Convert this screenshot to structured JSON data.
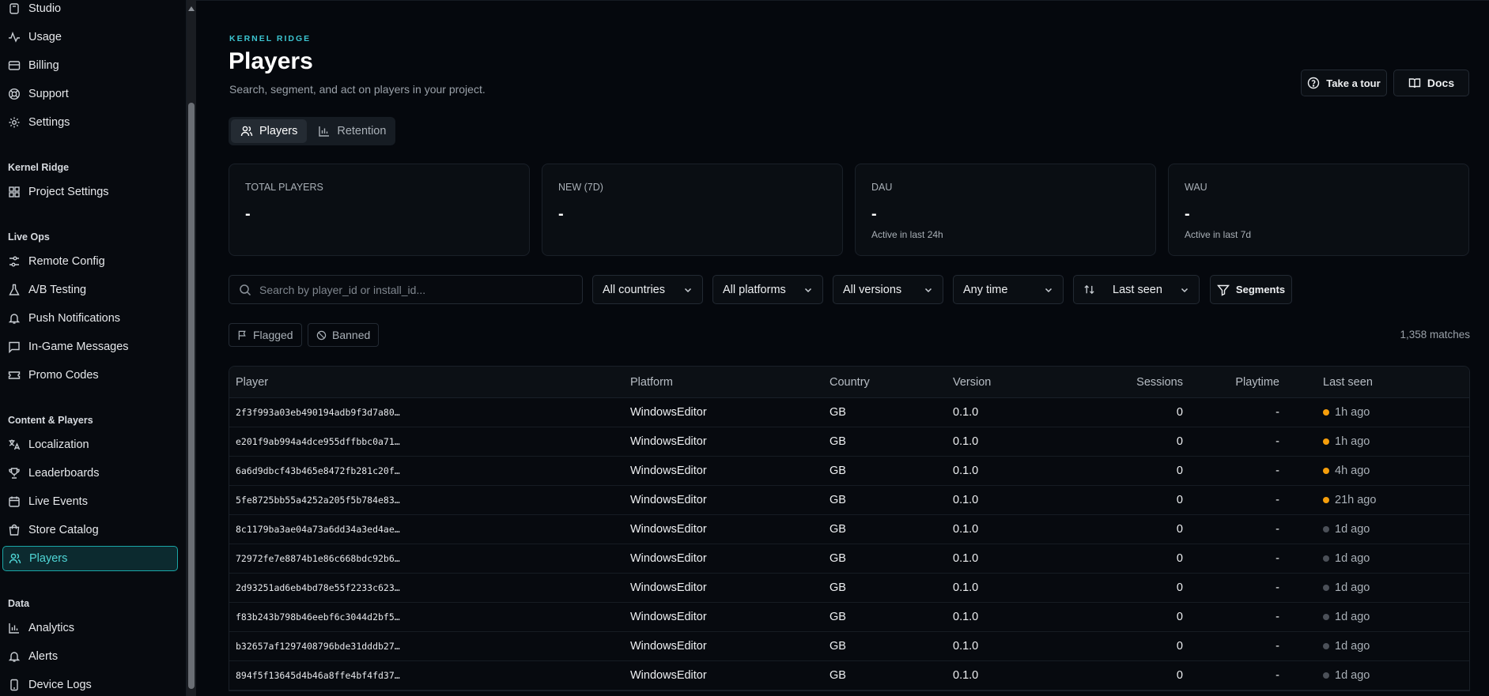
{
  "sidebar": {
    "top_items": [
      {
        "label": "Studio",
        "icon": "studio-icon"
      },
      {
        "label": "Usage",
        "icon": "activity-icon"
      },
      {
        "label": "Billing",
        "icon": "credit-card-icon"
      },
      {
        "label": "Support",
        "icon": "lifebuoy-icon"
      },
      {
        "label": "Settings",
        "icon": "gear-icon"
      }
    ],
    "sections": [
      {
        "title": "Kernel Ridge",
        "items": [
          {
            "label": "Project Settings",
            "icon": "grid-icon"
          }
        ]
      },
      {
        "title": "Live Ops",
        "items": [
          {
            "label": "Remote Config",
            "icon": "sliders-icon"
          },
          {
            "label": "A/B Testing",
            "icon": "flask-icon"
          },
          {
            "label": "Push Notifications",
            "icon": "bell-icon"
          },
          {
            "label": "In-Game Messages",
            "icon": "message-icon"
          },
          {
            "label": "Promo Codes",
            "icon": "ticket-icon"
          }
        ]
      },
      {
        "title": "Content & Players",
        "items": [
          {
            "label": "Localization",
            "icon": "translate-icon"
          },
          {
            "label": "Leaderboards",
            "icon": "trophy-icon"
          },
          {
            "label": "Live Events",
            "icon": "calendar-icon"
          },
          {
            "label": "Store Catalog",
            "icon": "shopping-bag-icon"
          },
          {
            "label": "Players",
            "icon": "users-icon",
            "active": true
          }
        ]
      },
      {
        "title": "Data",
        "items": [
          {
            "label": "Analytics",
            "icon": "bar-chart-icon"
          },
          {
            "label": "Alerts",
            "icon": "bell-icon"
          },
          {
            "label": "Device Logs",
            "icon": "smartphone-icon"
          }
        ]
      }
    ]
  },
  "header": {
    "eyebrow": "KERNEL RIDGE",
    "title": "Players",
    "subtitle": "Search, segment, and act on players in your project.",
    "tour_label": "Take a tour",
    "docs_label": "Docs"
  },
  "tabs": [
    {
      "label": "Players",
      "icon": "users-icon",
      "active": true
    },
    {
      "label": "Retention",
      "icon": "bar-chart-icon",
      "active": false
    }
  ],
  "stats": [
    {
      "label": "TOTAL PLAYERS",
      "value": "-",
      "note": ""
    },
    {
      "label": "NEW (7D)",
      "value": "-",
      "note": ""
    },
    {
      "label": "DAU",
      "value": "-",
      "note": "Active in last 24h"
    },
    {
      "label": "WAU",
      "value": "-",
      "note": "Active in last 7d"
    }
  ],
  "filters": {
    "search_placeholder": "Search by player_id or install_id...",
    "countries": "All countries",
    "platforms": "All platforms",
    "versions": "All versions",
    "time": "Any time",
    "sort": "Last seen",
    "segments": "Segments",
    "flagged": "Flagged",
    "banned": "Banned",
    "matches": "1,358 matches"
  },
  "table": {
    "columns": [
      "Player",
      "Platform",
      "Country",
      "Version",
      "Sessions",
      "Playtime",
      "Last seen"
    ],
    "rows": [
      {
        "player": "2f3f993a03eb490194adb9f3d7a80…",
        "platform": "WindowsEditor",
        "country": "GB",
        "version": "0.1.0",
        "sessions": "0",
        "playtime": "-",
        "last_seen": "1h ago",
        "status": "recent"
      },
      {
        "player": "e201f9ab994a4dce955dffbbc0a71…",
        "platform": "WindowsEditor",
        "country": "GB",
        "version": "0.1.0",
        "sessions": "0",
        "playtime": "-",
        "last_seen": "1h ago",
        "status": "recent"
      },
      {
        "player": "6a6d9dbcf43b465e8472fb281c20f…",
        "platform": "WindowsEditor",
        "country": "GB",
        "version": "0.1.0",
        "sessions": "0",
        "playtime": "-",
        "last_seen": "4h ago",
        "status": "recent"
      },
      {
        "player": "5fe8725bb55a4252a205f5b784e83…",
        "platform": "WindowsEditor",
        "country": "GB",
        "version": "0.1.0",
        "sessions": "0",
        "playtime": "-",
        "last_seen": "21h ago",
        "status": "recent"
      },
      {
        "player": "8c1179ba3ae04a73a6dd34a3ed4ae…",
        "platform": "WindowsEditor",
        "country": "GB",
        "version": "0.1.0",
        "sessions": "0",
        "playtime": "-",
        "last_seen": "1d ago",
        "status": "idle"
      },
      {
        "player": "72972fe7e8874b1e86c668bdc92b6…",
        "platform": "WindowsEditor",
        "country": "GB",
        "version": "0.1.0",
        "sessions": "0",
        "playtime": "-",
        "last_seen": "1d ago",
        "status": "idle"
      },
      {
        "player": "2d93251ad6eb4bd78e55f2233c623…",
        "platform": "WindowsEditor",
        "country": "GB",
        "version": "0.1.0",
        "sessions": "0",
        "playtime": "-",
        "last_seen": "1d ago",
        "status": "idle"
      },
      {
        "player": "f83b243b798b46eebf6c3044d2bf5…",
        "platform": "WindowsEditor",
        "country": "GB",
        "version": "0.1.0",
        "sessions": "0",
        "playtime": "-",
        "last_seen": "1d ago",
        "status": "idle"
      },
      {
        "player": "b32657af1297408796bde31dddb27…",
        "platform": "WindowsEditor",
        "country": "GB",
        "version": "0.1.0",
        "sessions": "0",
        "playtime": "-",
        "last_seen": "1d ago",
        "status": "idle"
      },
      {
        "player": "894f5f13645d4b46a8ffe4bf4fd37…",
        "platform": "WindowsEditor",
        "country": "GB",
        "version": "0.1.0",
        "sessions": "0",
        "playtime": "-",
        "last_seen": "1d ago",
        "status": "idle"
      }
    ]
  },
  "colors": {
    "accent": "#3cc4d0",
    "status_recent": "#f59e0b",
    "status_idle": "#4b5058"
  }
}
